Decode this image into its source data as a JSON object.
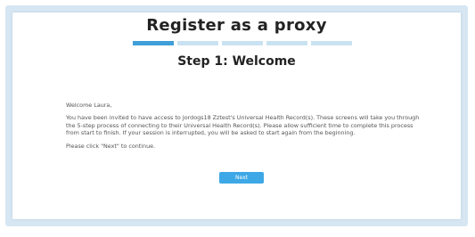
{
  "header": {
    "title": "Register as a proxy",
    "subtitle": "Step 1: Welcome"
  },
  "progress": {
    "total_steps": 5,
    "current_step": 1
  },
  "body": {
    "greeting": "Welcome Laura,",
    "paragraph": "You have been invited to have access to Jordogs18 Zztest's Universal Health Record(s). These screens will take you through the 5-step process of connecting to their Universal Health Record(s). Please allow sufficient time to complete this process from start to finish. If your session is interrupted, you will be asked to start again from the beginning.",
    "instruction": "Please click \"Next\" to continue."
  },
  "actions": {
    "next_label": "Next"
  },
  "colors": {
    "accent": "#3ea8e6",
    "progress_active": "#3f9fd8",
    "progress_inactive": "#c9e2f2",
    "frame": "#d6e6f2"
  }
}
